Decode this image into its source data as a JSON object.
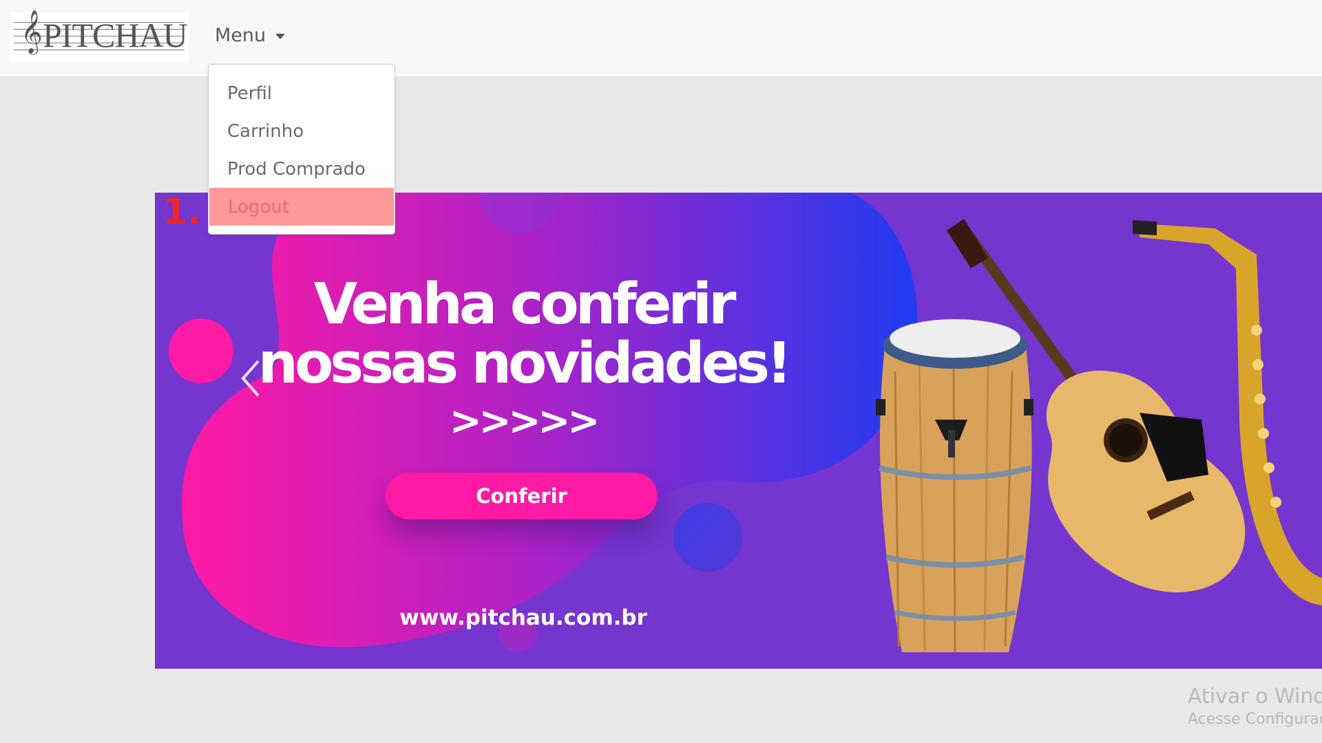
{
  "navbar": {
    "logo_text": "PITCHAU",
    "menu_label": "Menu",
    "menu_caret_icon": "caret-down-icon"
  },
  "dropdown": {
    "items": [
      {
        "label": "Perfil",
        "active": false
      },
      {
        "label": "Carrinho",
        "active": false
      },
      {
        "label": "Prod Comprado",
        "active": false
      },
      {
        "label": "Logout",
        "active": true
      }
    ]
  },
  "banner": {
    "headline_line1": "Venha conferir",
    "headline_line2": "nossas novidades!",
    "arrows": ">>>>>",
    "button_label": "Conferir",
    "url": "www.pitchau.com.br",
    "prev_icon": "chevron-left-icon"
  },
  "annotation": "1.",
  "watermark": {
    "line1": "Ativar o Windows",
    "line2": "Acesse Configurações"
  },
  "colors": {
    "banner_bg": "#7535cf",
    "pink": "#ff1aa6",
    "blue": "#2a3ff0",
    "logout_highlight": "#ff9898",
    "page_bg": "#e8e8e8"
  }
}
